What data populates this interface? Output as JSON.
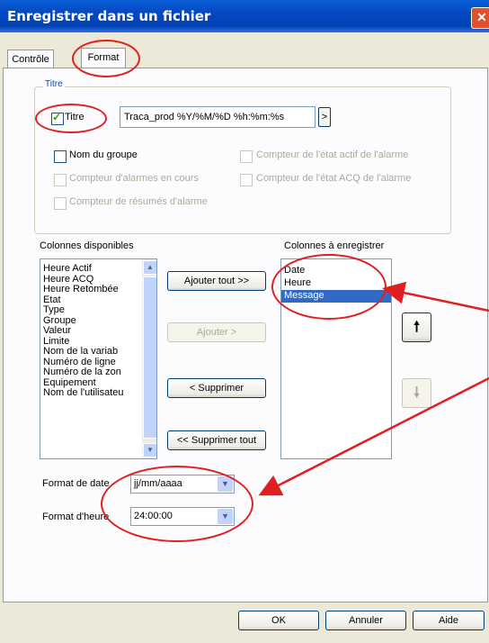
{
  "window": {
    "title": "Enregistrer dans un fichier",
    "close_glyph": "✕"
  },
  "tabs": [
    {
      "label": "Contrôle"
    },
    {
      "label": "Format"
    }
  ],
  "title_group": {
    "label": "Titre",
    "title_checkbox_label": "Titre",
    "title_value": "Traca_prod %Y/%M/%D %h:%m:%s",
    "expand_button": ">",
    "options": [
      {
        "label": "Nom du groupe"
      },
      {
        "label": "Compteur de l'état actif de l'alarme"
      },
      {
        "label": "Compteur d'alarmes en cours"
      },
      {
        "label": "Compteur de l'état ACQ de l'alarme"
      },
      {
        "label": "Compteur de résumés d'alarme"
      }
    ]
  },
  "available_columns": {
    "label": "Colonnes disponibles",
    "items": [
      "Heure Actif",
      "Heure ACQ",
      "Heure Retombée",
      "Etat",
      "Type",
      "Groupe",
      "Valeur",
      "Limite",
      "Nom de la variab",
      "Numéro de ligne",
      "Numéro de la zon",
      "Equipement",
      "Nom de l'utilisateu"
    ]
  },
  "selected_columns": {
    "label": "Colonnes à enregistrer",
    "items": [
      "Date",
      "Heure",
      "Message"
    ],
    "selected": "Message"
  },
  "buttons": {
    "add_all": "Ajouter tout >>",
    "add": "Ajouter >",
    "remove": "< Supprimer",
    "remove_all": "<< Supprimer tout",
    "move_up_glyph": "🠕",
    "move_down_glyph": "🠗",
    "ok": "OK",
    "cancel": "Annuler",
    "help": "Aide"
  },
  "date_format": {
    "label": "Format de date",
    "value": "jj/mm/aaaa"
  },
  "time_format": {
    "label": "Format d'heure",
    "value": "24:00:00"
  },
  "colors": {
    "titlebar": "#0548c0",
    "selection": "#316ac5",
    "annotation": "#e02020"
  }
}
